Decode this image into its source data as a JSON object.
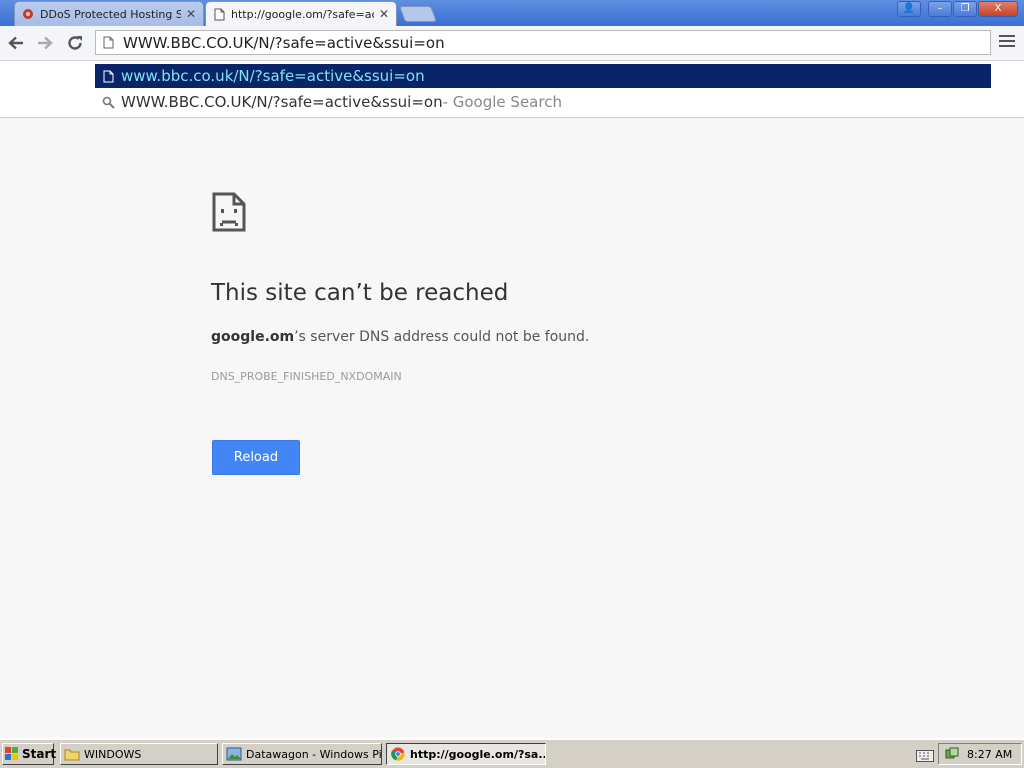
{
  "tabs": [
    {
      "title": "DDoS Protected Hosting Solu",
      "close": "✕",
      "active": false
    },
    {
      "title": "http://google.om/?safe=acti",
      "close": "✕",
      "active": true
    }
  ],
  "window_controls": {
    "user": "👤",
    "minimize": "–",
    "maximize": "❐",
    "close": "X"
  },
  "omnibox": {
    "value": "WWW.BBC.CO.UK/N/?safe=active&ssui=on"
  },
  "suggestions": [
    {
      "text": "www.bbc.co.uk/N/?safe=active&ssui=on",
      "suffix": "",
      "icon": "page-icon"
    },
    {
      "text": "WWW.BBC.CO.UK/N/?safe=active&ssui=on",
      "suffix": " - Google Search",
      "icon": "search-icon"
    }
  ],
  "error": {
    "heading": "This site can’t be reached",
    "host": "google.om",
    "message": "’s server DNS address could not be found.",
    "code": "DNS_PROBE_FINISHED_NXDOMAIN",
    "reload_label": "Reload"
  },
  "taskbar": {
    "start_label": "Start",
    "tasks": [
      {
        "label": "WINDOWS",
        "icon": "folder-icon"
      },
      {
        "label": "Datawagon - Windows Pi...",
        "icon": "picture-viewer-icon"
      },
      {
        "label": "http://google.om/?sa...",
        "icon": "chrome-icon"
      }
    ],
    "clock": "8:27 AM"
  },
  "colors": {
    "accent": "#4285f4",
    "selection_bg": "#0a246a",
    "selection_text": "#7fe3f0",
    "titlebar": "#3b6fd3"
  }
}
